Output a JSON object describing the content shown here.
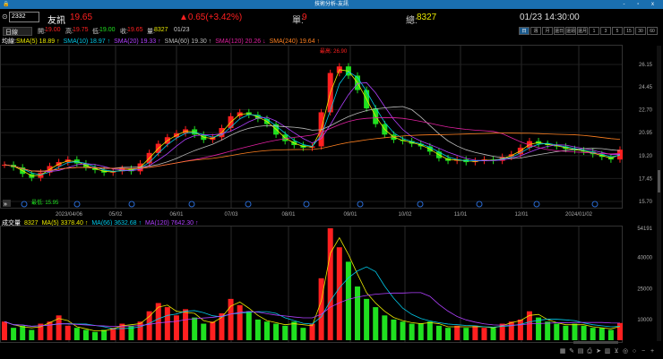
{
  "window": {
    "title": "技術分析-友訊",
    "controls": "- ▫ x"
  },
  "quote": {
    "code": "2332",
    "name": "友訊",
    "price": "19.65",
    "change": "▲0.65(+3.42%)",
    "single_label": "單:",
    "single": "9",
    "total_label": "總:",
    "total": "8327",
    "time": "01/23 14:30:00"
  },
  "ohlc": {
    "period": "日線",
    "open_label": "開:",
    "open": "19.00",
    "high_label": "高:",
    "high": "19.75",
    "low_label": "低:",
    "low": "19.00",
    "close_label": "收:",
    "close": "19.65",
    "vol_label": "量:",
    "vol": "8327",
    "date": "01/23"
  },
  "periods": [
    "日",
    "週",
    "月",
    "還日",
    "還週",
    "還月",
    "1",
    "3",
    "5",
    "15",
    "30",
    "60"
  ],
  "ma_legend": {
    "label": "均線:",
    "items": [
      "SMA(5) 18.89 ↑",
      "SMA(10) 18.97 ↑",
      "SMA(20) 19.33 ↑",
      "SMA(60) 19.30 ↑",
      "SMA(120) 20.26 ↓",
      "SMA(240) 19.64 ↑"
    ],
    "colors": [
      "#e8e800",
      "#00c8e8",
      "#b040ff",
      "#bbbbbb",
      "#e020a0",
      "#ff8020"
    ]
  },
  "vol_legend": {
    "label": "成交量",
    "value": "8327",
    "items": [
      "MA(5) 3378.40 ↑",
      "MA(66) 3632.68 ↑",
      "MA(120) 7642.30 ↑"
    ],
    "colors": [
      "#e8e800",
      "#00c8e8",
      "#b040ff"
    ]
  },
  "annotations": {
    "high": "最高: 26.90",
    "low": "最低: 15.95"
  },
  "chart_data": {
    "type": "candlestick",
    "price_ticks": [
      "26.15",
      "24.45",
      "22.70",
      "20.95",
      "19.20",
      "17.45",
      "15.70"
    ],
    "price_range": [
      15.7,
      26.15
    ],
    "vol_ticks": [
      "54191",
      "40000",
      "25000",
      "10000"
    ],
    "vol_range": [
      0,
      54191
    ],
    "date_ticks": [
      "2023/04/06",
      "05/02",
      "06/01",
      "07/03",
      "08/01",
      "09/01",
      "10/02",
      "11/01",
      "12/01",
      "2024/01/02"
    ],
    "closes": [
      18.5,
      18.3,
      17.8,
      17.5,
      17.9,
      18.4,
      18.7,
      18.9,
      18.6,
      18.3,
      18.1,
      17.9,
      18.0,
      18.2,
      18.0,
      18.6,
      19.4,
      20.1,
      20.6,
      20.9,
      21.2,
      20.8,
      20.4,
      20.6,
      21.3,
      22.2,
      22.5,
      22.3,
      22.0,
      21.6,
      20.8,
      20.3,
      20.0,
      19.8,
      19.9,
      22.5,
      25.5,
      26.0,
      25.3,
      24.2,
      22.8,
      21.6,
      20.8,
      20.4,
      20.3,
      20.1,
      19.9,
      19.5,
      19.0,
      18.8,
      18.9,
      18.7,
      18.8,
      18.9,
      18.8,
      19.1,
      19.3,
      19.8,
      20.3,
      20.1,
      20.0,
      19.9,
      19.7,
      19.6,
      19.5,
      19.3,
      19.1,
      18.9,
      19.65
    ],
    "volumes": [
      9000,
      6000,
      7000,
      5000,
      8000,
      9000,
      12000,
      7000,
      6000,
      5000,
      4000,
      5000,
      6000,
      8000,
      7000,
      9000,
      14000,
      18000,
      16000,
      12000,
      15000,
      11000,
      8000,
      9000,
      13000,
      20000,
      17000,
      14000,
      10000,
      9000,
      8000,
      7000,
      9000,
      6000,
      8000,
      30000,
      54191,
      45000,
      38000,
      26000,
      20000,
      16000,
      12000,
      10000,
      9000,
      8000,
      8000,
      9000,
      7000,
      6000,
      7000,
      6000,
      7000,
      6000,
      6000,
      8000,
      9000,
      10000,
      14000,
      11000,
      9000,
      8000,
      7000,
      8000,
      7000,
      6000,
      6000,
      5000,
      8327
    ]
  }
}
